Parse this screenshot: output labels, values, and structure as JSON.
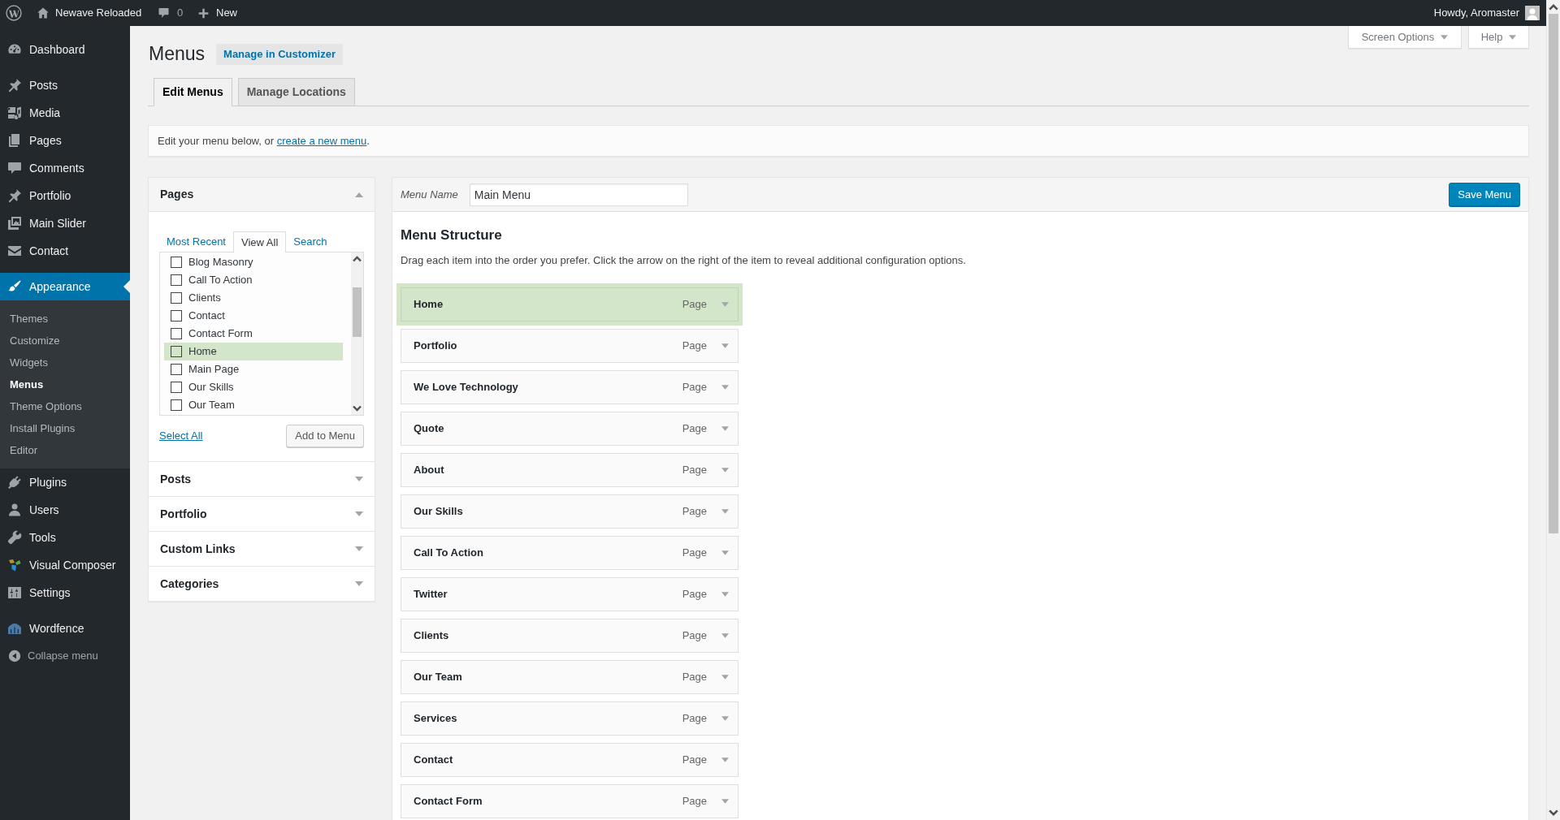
{
  "admin_bar": {
    "site_name": "Newave Reloaded",
    "comment_count": "0",
    "new_label": "New",
    "greeting": "Howdy, Aromaster"
  },
  "sidebar": {
    "groups": [
      {
        "items": [
          {
            "label": "Dashboard",
            "selected": false
          }
        ]
      },
      {
        "items": [
          {
            "label": "Posts",
            "selected": false
          },
          {
            "label": "Media",
            "selected": false
          },
          {
            "label": "Pages",
            "selected": false
          },
          {
            "label": "Comments",
            "selected": false
          },
          {
            "label": "Portfolio",
            "selected": false
          },
          {
            "label": "Main Slider",
            "selected": false
          },
          {
            "label": "Contact",
            "selected": false
          }
        ]
      },
      {
        "items": [
          {
            "label": "Appearance",
            "selected": true,
            "children": [
              {
                "label": "Themes",
                "selected": false
              },
              {
                "label": "Customize",
                "selected": false
              },
              {
                "label": "Widgets",
                "selected": false
              },
              {
                "label": "Menus",
                "selected": true
              },
              {
                "label": "Theme Options",
                "selected": false
              },
              {
                "label": "Install Plugins",
                "selected": false
              },
              {
                "label": "Editor",
                "selected": false
              }
            ]
          },
          {
            "label": "Plugins",
            "selected": false
          },
          {
            "label": "Users",
            "selected": false
          },
          {
            "label": "Tools",
            "selected": false
          },
          {
            "label": "Visual Composer",
            "selected": false
          },
          {
            "label": "Settings",
            "selected": false
          }
        ]
      },
      {
        "items": [
          {
            "label": "Wordfence",
            "selected": false
          }
        ]
      }
    ],
    "collapse_label": "Collapse menu"
  },
  "header": {
    "title": "Menus",
    "customizer_button": "Manage in Customizer",
    "screen_options": "Screen Options",
    "help": "Help"
  },
  "tabs": [
    {
      "label": "Edit Menus",
      "selected": true
    },
    {
      "label": "Manage Locations",
      "selected": false
    }
  ],
  "notice": {
    "text": "Edit your menu below, or ",
    "link": "create a new menu",
    "end": "."
  },
  "add_items": {
    "sections": [
      {
        "title": "Pages",
        "expanded": true,
        "tabs": [
          {
            "label": "Most Recent",
            "selected": false
          },
          {
            "label": "View All",
            "selected": true
          },
          {
            "label": "Search",
            "selected": false
          }
        ],
        "pages": [
          {
            "label": "Blog Masonry",
            "checked": false,
            "highlighted": false
          },
          {
            "label": "Call To Action",
            "checked": false,
            "highlighted": false
          },
          {
            "label": "Clients",
            "checked": false,
            "highlighted": false
          },
          {
            "label": "Contact",
            "checked": false,
            "highlighted": false
          },
          {
            "label": "Contact Form",
            "checked": false,
            "highlighted": false
          },
          {
            "label": "Home",
            "checked": false,
            "highlighted": true
          },
          {
            "label": "Main Page",
            "checked": false,
            "highlighted": false
          },
          {
            "label": "Our Skills",
            "checked": false,
            "highlighted": false
          },
          {
            "label": "Our Team",
            "checked": false,
            "highlighted": false
          }
        ],
        "select_all": "Select All",
        "add_button": "Add to Menu"
      },
      {
        "title": "Posts",
        "expanded": false
      },
      {
        "title": "Portfolio",
        "expanded": false
      },
      {
        "title": "Custom Links",
        "expanded": false
      },
      {
        "title": "Categories",
        "expanded": false
      }
    ]
  },
  "menu_editor": {
    "name_label": "Menu Name",
    "name_value": "Main Menu",
    "save_button": "Save Menu",
    "structure_title": "Menu Structure",
    "instructions": "Drag each item into the order you prefer. Click the arrow on the right of the item to reveal additional configuration options.",
    "items": [
      {
        "title": "Home",
        "type": "Page",
        "highlighted": true
      },
      {
        "title": "Portfolio",
        "type": "Page",
        "highlighted": false
      },
      {
        "title": "We Love Technology",
        "type": "Page",
        "highlighted": false
      },
      {
        "title": "Quote",
        "type": "Page",
        "highlighted": false
      },
      {
        "title": "About",
        "type": "Page",
        "highlighted": false
      },
      {
        "title": "Our Skills",
        "type": "Page",
        "highlighted": false
      },
      {
        "title": "Call To Action",
        "type": "Page",
        "highlighted": false
      },
      {
        "title": "Twitter",
        "type": "Page",
        "highlighted": false
      },
      {
        "title": "Clients",
        "type": "Page",
        "highlighted": false
      },
      {
        "title": "Our Team",
        "type": "Page",
        "highlighted": false
      },
      {
        "title": "Services",
        "type": "Page",
        "highlighted": false
      },
      {
        "title": "Contact",
        "type": "Page",
        "highlighted": false
      },
      {
        "title": "Contact Form",
        "type": "Page",
        "highlighted": false
      }
    ]
  }
}
